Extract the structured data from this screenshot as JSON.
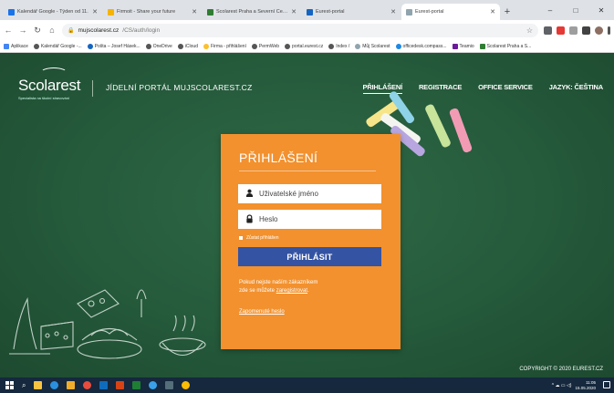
{
  "browser": {
    "tabs": [
      {
        "title": "Kalendář Google - Týden od 11.",
        "color": "#1a73e8",
        "active": false
      },
      {
        "title": "Firmoit - Share your future",
        "color": "#f5b400",
        "active": false
      },
      {
        "title": "Scolarest Praha a Severní Čechy",
        "color": "#2e7d32",
        "active": false
      },
      {
        "title": "Eurest-portal",
        "color": "#1565c0",
        "active": false
      },
      {
        "title": "Eurest-portal",
        "color": "#90a4ae",
        "active": true
      }
    ],
    "new_tab": "+",
    "window_controls": {
      "minimize": "–",
      "maximize": "□",
      "close": "✕"
    },
    "url": {
      "host": "mujscolarest.cz",
      "path": "/CS/auth/login"
    },
    "bookmarks": [
      "Aplikace",
      "Kalendář Google -...",
      "Pošta – Josef Hásek...",
      "OneDrive",
      "iCloud",
      "Firma - přihlášení",
      "PermWeb",
      "portal.eurest.cz",
      "Index /",
      "Můj Scolarest",
      "officedesk.compass...",
      "Teamio",
      "Scolarest Praha a S..."
    ]
  },
  "header": {
    "logo_text": "Scolarest",
    "logo_tagline": "Specialista na školní stravování",
    "portal_title": "JÍDELNÍ PORTÁL MUJSCOLAREST.CZ",
    "nav": [
      {
        "label": "PŘIHLÁŠENÍ",
        "active": true
      },
      {
        "label": "REGISTRACE",
        "active": false
      },
      {
        "label": "OFFICE SERVICE",
        "active": false
      },
      {
        "label": "JAZYK: ČEŠTINA",
        "active": false
      }
    ]
  },
  "login": {
    "title": "PŘIHLÁŠENÍ",
    "username_placeholder": "Uživatelské jméno",
    "password_placeholder": "Heslo",
    "remember_label": "Zůstat přihlášen",
    "submit_label": "PŘIHLÁSIT",
    "info_line1": "Pokud nejste naším zákazníkem",
    "info_line2": "zde se můžete",
    "info_link": "zaregistrovat",
    "info_end": ".",
    "forgot_label": "Zapomenuté heslo"
  },
  "footer": {
    "copyright": "COPYRIGHT © 2020 EUREST.CZ"
  },
  "taskbar": {
    "time": "11:05",
    "date": "15.05.2020"
  },
  "colors": {
    "chalkboard": "#2f6a47",
    "login_panel": "#f2912e",
    "submit_button": "#3453a3"
  }
}
